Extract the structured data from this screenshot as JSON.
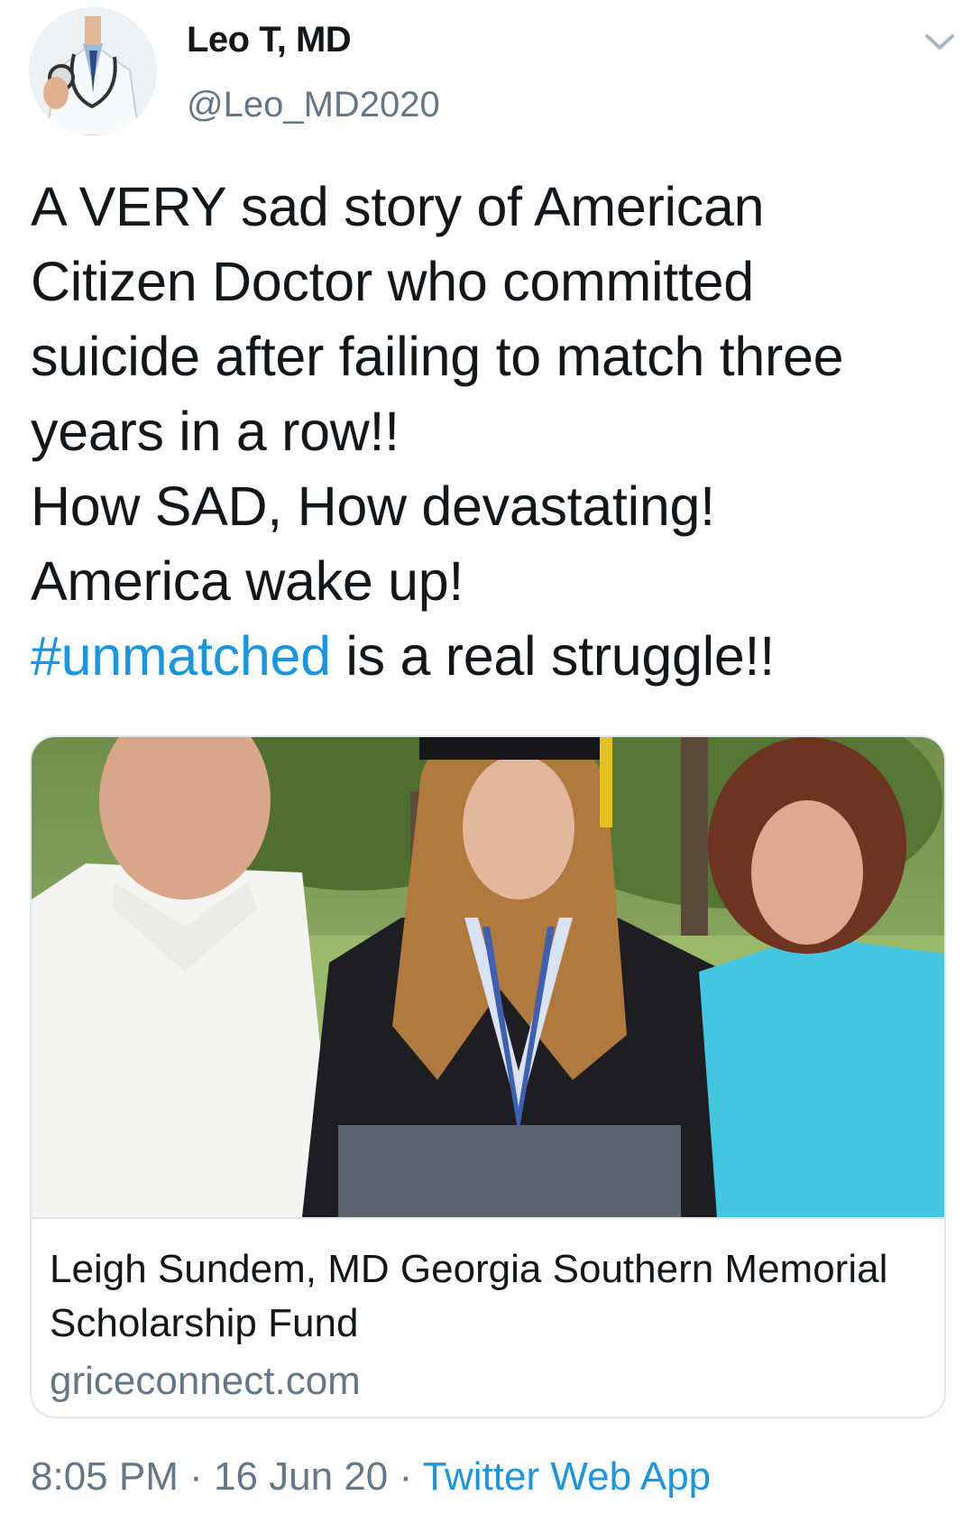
{
  "user": {
    "display_name": "Leo T, MD",
    "handle": "@Leo_MD2020",
    "avatar_icon": "doctor-stethoscope-avatar"
  },
  "tweet": {
    "lines": [
      "A VERY sad story of American",
      "Citizen Doctor who committed",
      "suicide after failing to match three",
      "years in a row!!",
      "How SAD, How devastating!",
      "America wake up!"
    ],
    "hashtag": "#unmatched",
    "hashtag_rest": " is a real struggle!!"
  },
  "card": {
    "image_alt": "Graduate in cap and gown with parents",
    "title": "Leigh Sundem, MD Georgia Southern Memorial Scholarship Fund",
    "domain": "griceconnect.com"
  },
  "meta": {
    "time": "8:05 PM",
    "separator": " · ",
    "date": "16 Jun 20",
    "source": "Twitter Web App"
  },
  "colors": {
    "text": "#14171a",
    "secondary": "#657786",
    "link": "#1b95e0",
    "border": "#e1e8ed"
  }
}
